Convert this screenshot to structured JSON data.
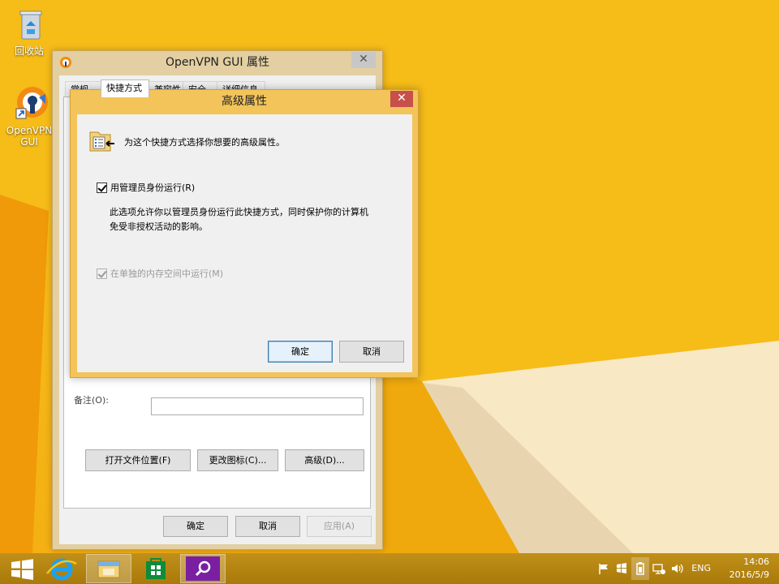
{
  "desktop": {
    "icons": [
      {
        "label": "回收站",
        "icon": "recycle-bin-icon"
      },
      {
        "label": "OpenVPN GUI",
        "icon": "openvpn-shortcut-icon"
      }
    ]
  },
  "props_window": {
    "title": "OpenVPN GUI 属性",
    "tabs": [
      {
        "label": "常规"
      },
      {
        "label": "快捷方式"
      },
      {
        "label": "兼容性"
      },
      {
        "label": "安全"
      },
      {
        "label": "详细信息"
      }
    ],
    "comment_label": "备注(O):",
    "buttons": {
      "open_location": "打开文件位置(F)",
      "change_icon": "更改图标(C)...",
      "advanced": "高级(D)...",
      "ok": "确定",
      "cancel": "取消",
      "apply": "应用(A)"
    }
  },
  "advanced_dialog": {
    "title": "高级属性",
    "header_text": "为这个快捷方式选择你想要的高级属性。",
    "run_as_admin": {
      "label": "用管理员身份运行(R)",
      "checked": true
    },
    "description_line1": "此选项允许你以管理员身份运行此快捷方式，同时保护你的计算机",
    "description_line2": "免受非授权活动的影响。",
    "separate_memory": {
      "label": "在单独的内存空间中运行(M)",
      "checked": true,
      "enabled": false
    },
    "ok": "确定",
    "cancel": "取消"
  },
  "taskbar": {
    "apps": [
      "start-icon",
      "internet-explorer-icon",
      "file-explorer-icon",
      "store-icon",
      "search-app-icon"
    ],
    "language": "ENG",
    "time": "14:06",
    "date": "2016/5/9"
  },
  "colors": {
    "accent": "#f4b014",
    "dialog_border": "#f2c45a",
    "close_red": "#c7504a"
  }
}
